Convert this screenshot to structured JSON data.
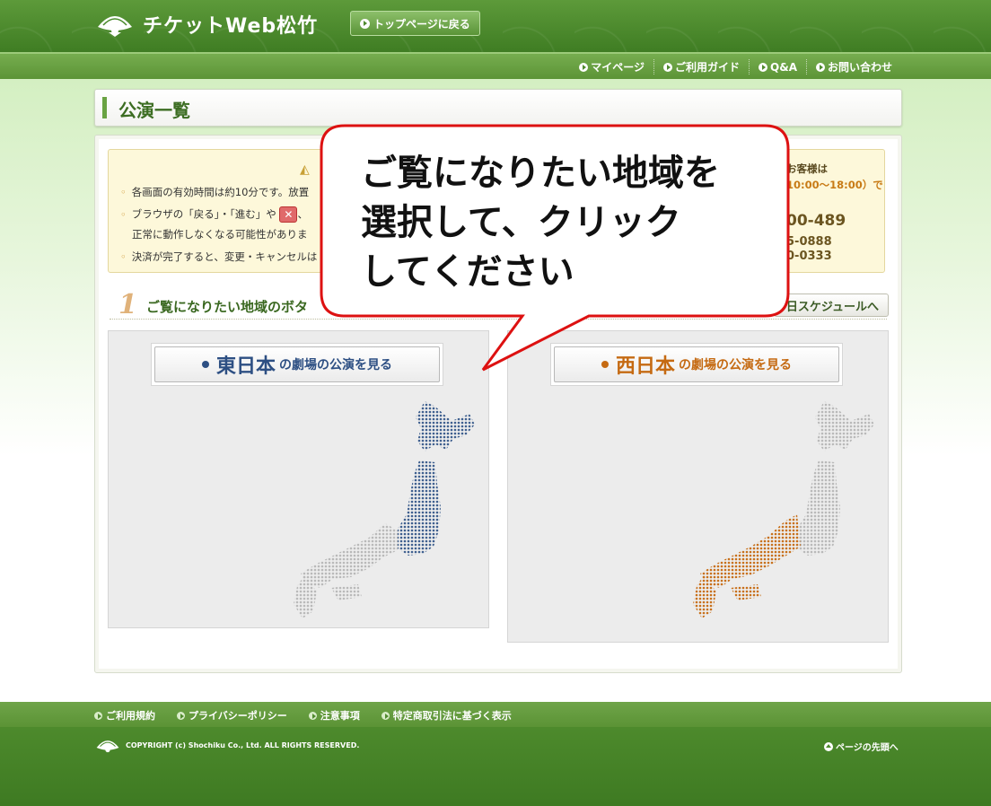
{
  "header": {
    "logo_text": "チケットWeb松竹",
    "top_page_button": "トップページに戻る"
  },
  "subnav": {
    "items": [
      "マイページ",
      "ご利用ガイド",
      "Q&A",
      "お問い合わせ"
    ]
  },
  "page": {
    "title": "公演一覧"
  },
  "notice": {
    "lines": [
      "各画面の有効時間は約10分です。放置",
      "ブラウザの「戻る」・「進む」や",
      "、",
      "正常に動作しなくなる可能性がありま",
      "決済が完了すると、変更・キャンセルは"
    ],
    "contact": {
      "line1": "お客様は",
      "line2": "10:00〜18:00）で",
      "phone1": "00-489",
      "phone2": "5-0888",
      "phone3": "0-0333"
    }
  },
  "step": {
    "number": "1",
    "text": "ご覧になりたい地域のボタ",
    "schedule_button": "日スケジュールへ"
  },
  "regions": {
    "east": {
      "big": "東日本",
      "small": "の劇場の公演を見る",
      "color": "#2d4f83"
    },
    "west": {
      "big": "西日本",
      "small": "の劇場の公演を見る",
      "color": "#c56a12"
    }
  },
  "callout": {
    "text": "ご覧になりたい地域を\n選択して、クリック\nしてください"
  },
  "footer": {
    "links": [
      "ご利用規約",
      "プライバシーポリシー",
      "注意事項",
      "特定商取引法に基づく表示"
    ],
    "copyright": "COPYRIGHT (c) Shochiku Co., Ltd. ALL RIGHTS RESERVED.",
    "page_top": "ページの先頭へ"
  }
}
